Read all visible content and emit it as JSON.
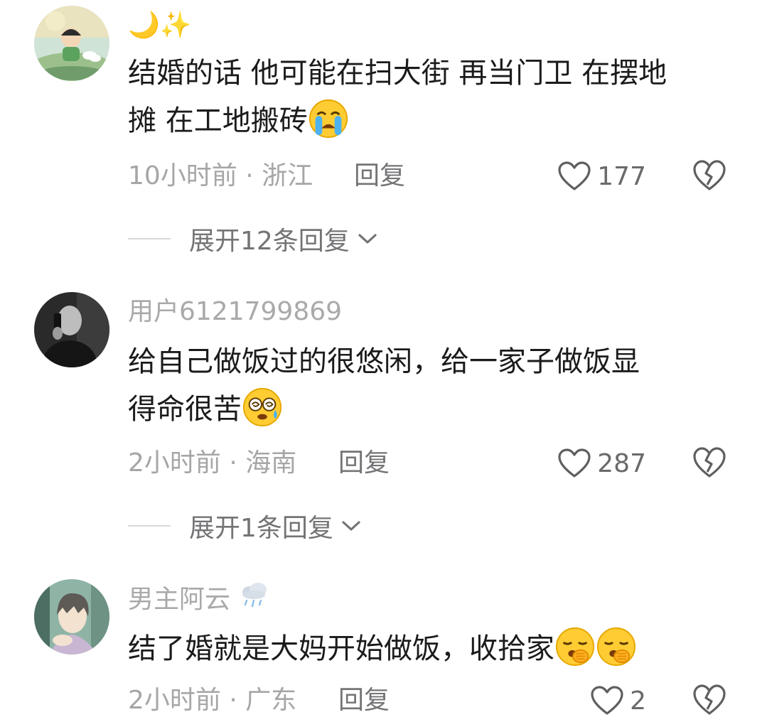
{
  "comments": [
    {
      "username": "🌙✨",
      "text_line1": "结婚的话 他可能在扫大街 再当门卫 在摆地",
      "text_line2": "摊 在工地搬砖",
      "emoji": [
        "loudly-crying-face"
      ],
      "time_location": "10小时前 · 浙江",
      "reply_label": "回复",
      "likes": "177",
      "expand_label": "展开12条回复"
    },
    {
      "username": "用户6121799869",
      "text_line1": "给自己做饭过的很悠闲，给一家子做饭显",
      "text_line2": "得命很苦",
      "emoji": [
        "dizzy-sweat-face"
      ],
      "time_location": "2小时前 · 海南",
      "reply_label": "回复",
      "likes": "287",
      "expand_label": "展开1条回复"
    },
    {
      "username": "男主阿云",
      "username_icon": "rain-cloud-icon",
      "text_line1": "结了婚就是大妈开始做饭，收拾家",
      "emoji": [
        "yawning-face",
        "yawning-face"
      ],
      "time_location": "2小时前 · 广东",
      "reply_label": "回复",
      "likes": "2"
    }
  ],
  "colors": {
    "text": "#1b1b1b",
    "secondary": "#a6a6a8",
    "reply": "#747477",
    "background": "#ffffff"
  }
}
